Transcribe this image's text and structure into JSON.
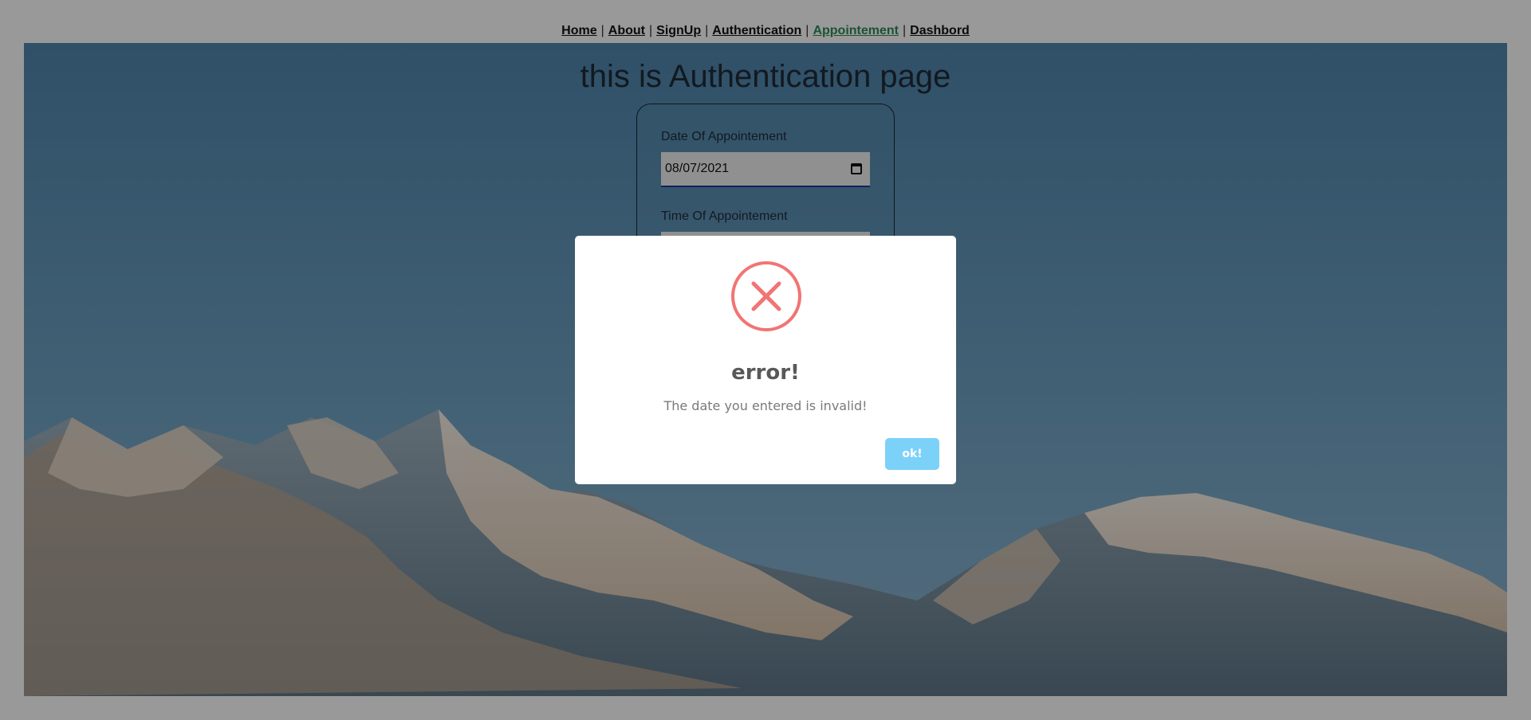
{
  "nav": {
    "links": [
      {
        "label": "Home"
      },
      {
        "label": "About"
      },
      {
        "label": "SignUp"
      },
      {
        "label": "Authentication"
      },
      {
        "label": "Appointement"
      },
      {
        "label": "Dashbord"
      }
    ],
    "active_label": "Appointement",
    "separator": "|"
  },
  "page": {
    "title": "this is Authentication page"
  },
  "form": {
    "date_label": "Date Of Appointement",
    "date_value": "08/07/2021",
    "time_label": "Time Of Appointement",
    "time_value": ""
  },
  "alert": {
    "icon": "error-x-circle-icon",
    "title": "error!",
    "text": "The date you entered is invalid!",
    "button_label": "ok!"
  },
  "colors": {
    "active_link": "#2e8b57",
    "error_icon": "#f27474",
    "ok_button": "#7cd1f9"
  }
}
